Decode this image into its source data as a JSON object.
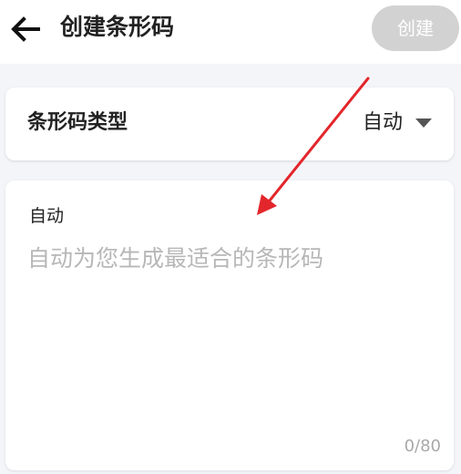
{
  "header": {
    "back_icon": "arrow-left-icon",
    "title": "创建条形码",
    "create_label": "创建"
  },
  "barcode_type": {
    "label": "条形码类型",
    "selected": "自动",
    "dropdown_icon": "caret-down-icon"
  },
  "content": {
    "label": "自动",
    "value": "",
    "placeholder": "自动为您生成最适合的条形码",
    "counter": "0/80"
  },
  "colors": {
    "background": "#f4f5f9",
    "card": "#ffffff",
    "create_button_disabled": "#d2d2d2",
    "placeholder_text": "#b7b7b7",
    "annotation_arrow": "#e3262b"
  }
}
